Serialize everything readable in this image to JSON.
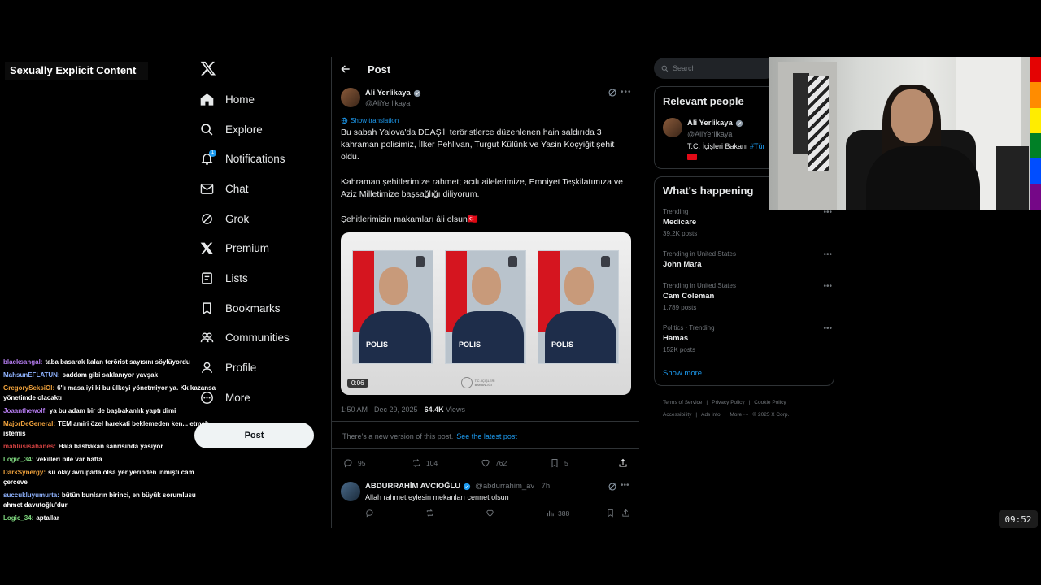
{
  "overlay": {
    "badge": "Sexually Explicit Content",
    "clock": "09:52"
  },
  "nav": {
    "items": [
      {
        "label": "Home",
        "icon": "home-icon"
      },
      {
        "label": "Explore",
        "icon": "search-icon"
      },
      {
        "label": "Notifications",
        "icon": "bell-icon"
      },
      {
        "label": "Chat",
        "icon": "mail-icon"
      },
      {
        "label": "Grok",
        "icon": "grok-icon"
      },
      {
        "label": "Premium",
        "icon": "x-icon"
      },
      {
        "label": "Lists",
        "icon": "list-icon"
      },
      {
        "label": "Bookmarks",
        "icon": "bookmark-icon"
      },
      {
        "label": "Communities",
        "icon": "people-icon"
      },
      {
        "label": "Profile",
        "icon": "person-icon"
      },
      {
        "label": "More",
        "icon": "more-circle-icon"
      }
    ],
    "notification_count": "1",
    "post_button": "Post"
  },
  "chat": [
    {
      "user": "blacksangal:",
      "color": "#b57cf0",
      "msg": "taba basarak kalan terörist sayısını söylüyordu"
    },
    {
      "user": "MahsunEFLATUN:",
      "color": "#8fb3ff",
      "msg": "saddam gibi saklanıyor yavşak"
    },
    {
      "user": "GregorySeksiOl:",
      "color": "#f0a23c",
      "msg": "6'lı masa iyi ki bu ülkeyi yönetmiyor ya. Kk kazansa yönetimde olacaktı"
    },
    {
      "user": "Joaanthewolf:",
      "color": "#b57cf0",
      "msg": "ya bu adam bir de başbakanlık yaptı dimi"
    },
    {
      "user": "MajorDeGeneral:",
      "color": "#f0a23c",
      "msg": "TEM amiri özel harekati beklemeden ken... etmek istemis"
    },
    {
      "user": "mahlusisahanes:",
      "color": "#d04040",
      "msg": "Hala basbakan sanrisinda yasiyor"
    },
    {
      "user": "Logic_34:",
      "color": "#7fd87f",
      "msg": "vekilleri bile var hatta"
    },
    {
      "user": "DarkSynergy:",
      "color": "#f0a23c",
      "msg": "su olay avrupada olsa yer yerinden inmişti cam çerceve"
    },
    {
      "user": "succukluyumurta:",
      "color": "#8fb3ff",
      "msg": "bütün bunların birinci, en büyük sorumlusu ahmet davutoğlu'dur"
    },
    {
      "user": "Logic_34:",
      "color": "#7fd87f",
      "msg": "aptallar"
    }
  ],
  "main": {
    "title": "Post",
    "tweet": {
      "name": "Ali Yerlikaya",
      "handle": "@AliYerlikaya",
      "show_translation": "Show translation",
      "p1": "Bu sabah Yalova'da DEAŞ'lı teröristlerce düzenlenen hain saldırıda 3 kahraman polisimiz, İlker Pehlivan, Turgut Külünk ve Yasin Koçyiğit şehit oldu.",
      "p2": "Kahraman şehitlerimize rahmet; acılı ailelerimize, Emniyet Teşkilatımıza ve Aziz Milletimize başsağlığı diliyorum.",
      "p3": "Şehitlerimizin makamları âli olsun🇹🇷",
      "video_time": "0:06",
      "polis_label": "POLIS",
      "logo_text": "T.C. İÇİŞLERİ BAKANLIĞI",
      "date": "1:50 AM · Dec 29, 2025 · ",
      "views_count": "64.4K",
      "views_label": " Views",
      "new_version_text": "There's a new version of this post.",
      "new_version_link": "See the latest post",
      "replies": "95",
      "reposts": "104",
      "likes": "762",
      "bookmarks": "5"
    },
    "reply": {
      "name": "ABDURRAHİM AVCIOĞLU",
      "handle": "@abdurrahim_av · 7h",
      "text": "Allah rahmet eylesin mekanları cennet olsun",
      "views": "388"
    }
  },
  "right": {
    "search_placeholder": "Search",
    "relevant": {
      "title": "Relevant people",
      "name": "Ali Yerlikaya",
      "handle": "@AliYerlikaya",
      "bio": "T.C. İçişleri Bakanı ",
      "bio_tag": "#Tür"
    },
    "happening": {
      "title": "What's happening",
      "trends": [
        {
          "ctx": "Trending",
          "name": "Medicare",
          "count": "39.2K posts"
        },
        {
          "ctx": "Trending in United States",
          "name": "John Mara",
          "count": ""
        },
        {
          "ctx": "Trending in United States",
          "name": "Cam Coleman",
          "count": "1,789 posts"
        },
        {
          "ctx": "Politics · Trending",
          "name": "Hamas",
          "count": "152K posts"
        }
      ],
      "show_more": "Show more"
    },
    "footer": [
      "Terms of Service",
      "|",
      "Privacy Policy",
      "|",
      "Cookie Policy",
      "|",
      "Accessibility",
      "|",
      "Ads info",
      "|",
      "More ···",
      "© 2025 X Corp."
    ]
  },
  "colors": {
    "accent": "#1d9bf0",
    "background": "#000000",
    "border": "#2f3336",
    "muted": "#71767b"
  },
  "rainbow": [
    "#e40303",
    "#ff8c00",
    "#ffed00",
    "#008026",
    "#004dff",
    "#750787"
  ]
}
